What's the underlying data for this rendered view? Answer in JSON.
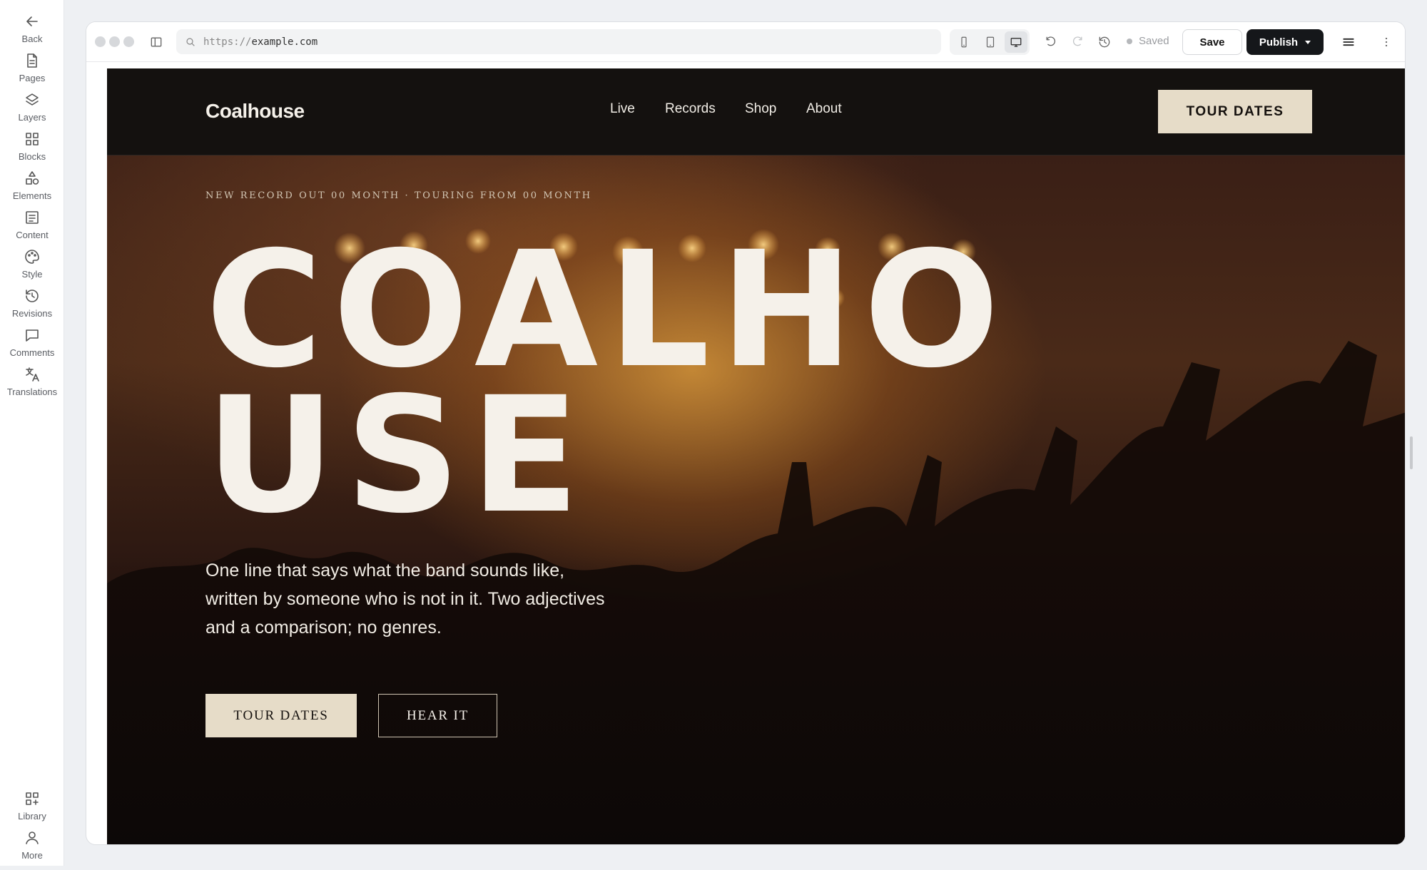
{
  "rail": {
    "items": [
      {
        "label": "Back",
        "icon": "arrow-left-icon"
      },
      {
        "label": "Pages",
        "icon": "page-icon"
      },
      {
        "label": "Layers",
        "icon": "layers-icon"
      },
      {
        "label": "Blocks",
        "icon": "blocks-icon"
      },
      {
        "label": "Elements",
        "icon": "shapes-icon"
      },
      {
        "label": "Content",
        "icon": "content-icon"
      },
      {
        "label": "Style",
        "icon": "palette-icon"
      },
      {
        "label": "Revisions",
        "icon": "history-icon"
      },
      {
        "label": "Comments",
        "icon": "comment-icon"
      },
      {
        "label": "Translations",
        "icon": "translate-icon"
      }
    ],
    "bottom": [
      {
        "label": "Library",
        "icon": "library-icon"
      },
      {
        "label": "More",
        "icon": "user-icon"
      }
    ]
  },
  "browser": {
    "url_scheme": "https://",
    "url_host": "example.com",
    "device_active": "desktop",
    "status": "Saved",
    "save_label": "Save",
    "publish_label": "Publish"
  },
  "site": {
    "logo": "Coalhouse",
    "nav": [
      "Live",
      "Records",
      "Shop",
      "About"
    ],
    "nav_cta": "TOUR DATES",
    "eyebrow": "NEW RECORD OUT 00 MONTH · TOURING FROM 00 MONTH",
    "headline": "COALHOUSE",
    "tagline": "One line that says what the band sounds like, written by someone who is not in it. Two adjectives and a comparison; no genres.",
    "primary_button": "TOUR DATES",
    "secondary_button": "HEAR IT"
  },
  "colors": {
    "accent": "#e6dcc8",
    "publish": "#15171a",
    "nav_bg": "#14110f"
  }
}
